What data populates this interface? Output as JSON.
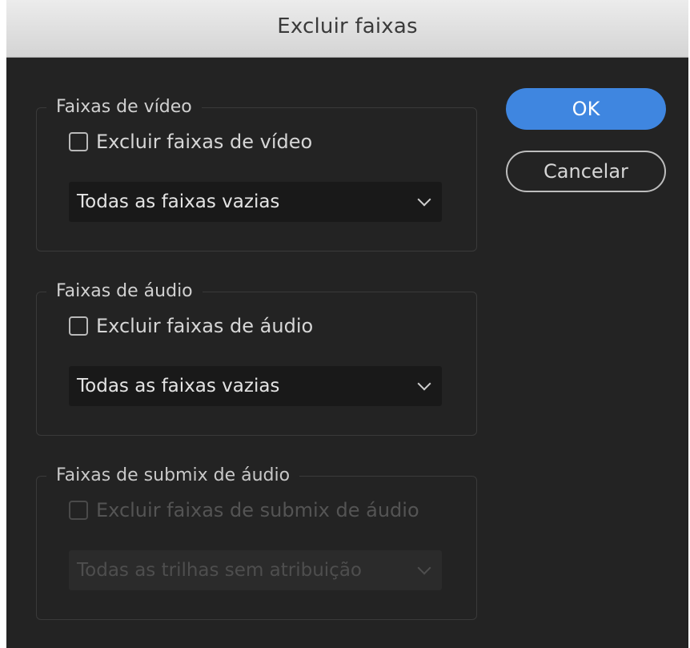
{
  "dialog": {
    "title": "Excluir faixas"
  },
  "buttons": {
    "ok_label": "OK",
    "cancel_label": "Cancelar"
  },
  "groups": [
    {
      "legend": "Faixas de vídeo",
      "checkbox_label": "Excluir faixas de vídeo",
      "checked": false,
      "select_value": "Todas as faixas vazias",
      "enabled": true
    },
    {
      "legend": "Faixas de áudio",
      "checkbox_label": "Excluir faixas de áudio",
      "checked": false,
      "select_value": "Todas as faixas vazias",
      "enabled": true
    },
    {
      "legend": "Faixas de submix de áudio",
      "checkbox_label": "Excluir faixas de submix de áudio",
      "checked": false,
      "select_value": "Todas as trilhas sem atribuição",
      "enabled": false
    }
  ],
  "colors": {
    "accent": "#3f86e0",
    "background": "#232323",
    "titlebar": "#dcdcdc"
  }
}
